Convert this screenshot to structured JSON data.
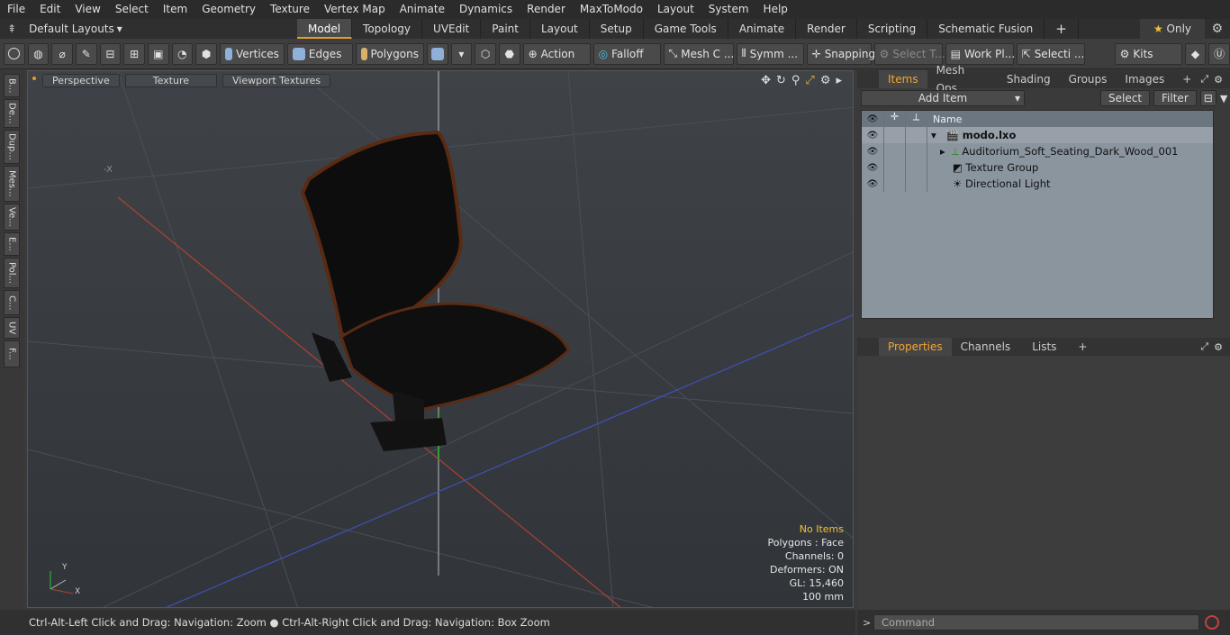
{
  "menu": [
    "File",
    "Edit",
    "View",
    "Select",
    "Item",
    "Geometry",
    "Texture",
    "Vertex Map",
    "Animate",
    "Dynamics",
    "Render",
    "MaxToModo",
    "Layout",
    "System",
    "Help"
  ],
  "layouts": {
    "label": "Default Layouts"
  },
  "tabs": [
    "Model",
    "Topology",
    "UVEdit",
    "Paint",
    "Layout",
    "Setup",
    "Game Tools",
    "Animate",
    "Render",
    "Scripting",
    "Schematic Fusion"
  ],
  "only_label": "Only",
  "toolbar": {
    "vertices": "Vertices",
    "edges": "Edges",
    "polygons": "Polygons",
    "action": "Action",
    "falloff": "Falloff",
    "mesh": "Mesh C ...",
    "symm": "Symm ...",
    "snapping": "Snapping",
    "select_t": "Select T...",
    "work_pl": "Work Pl...",
    "selecti": "Selecti ...",
    "kits": "Kits"
  },
  "left_tabs": [
    "B...",
    "De...",
    "Dup...",
    "Mes...",
    "Ve...",
    "E...",
    "Pol...",
    "C...",
    "UV",
    "F..."
  ],
  "viewport": {
    "perspective": "Perspective",
    "texture": "Texture",
    "viewport_textures": "Viewport Textures",
    "axis_label": "-X",
    "stats": {
      "no_items": "No Items",
      "polygons": "Polygons : Face",
      "channels": "Channels: 0",
      "deformers": "Deformers: ON",
      "gl": "GL: 15,460",
      "scale": "100 mm"
    }
  },
  "status_text": "Ctrl-Alt-Left Click and Drag: Navigation: Zoom ● Ctrl-Alt-Right Click and Drag: Navigation: Box Zoom",
  "items_panel": {
    "tabs": [
      "Items",
      "Mesh Ops",
      "Shading",
      "Groups",
      "Images"
    ],
    "add_item": "Add Item",
    "select": "Select",
    "filter": "Filter",
    "name_header": "Name",
    "rows": [
      "modo.lxo",
      "Auditorium_Soft_Seating_Dark_Wood_001",
      "Texture Group",
      "Directional Light"
    ]
  },
  "props_panel": {
    "tabs": [
      "Properties",
      "Channels",
      "Lists"
    ]
  },
  "command": {
    "placeholder": "Command"
  },
  "colors": {
    "accent": "#e69b2b",
    "tree_bg": "#8b959e"
  }
}
